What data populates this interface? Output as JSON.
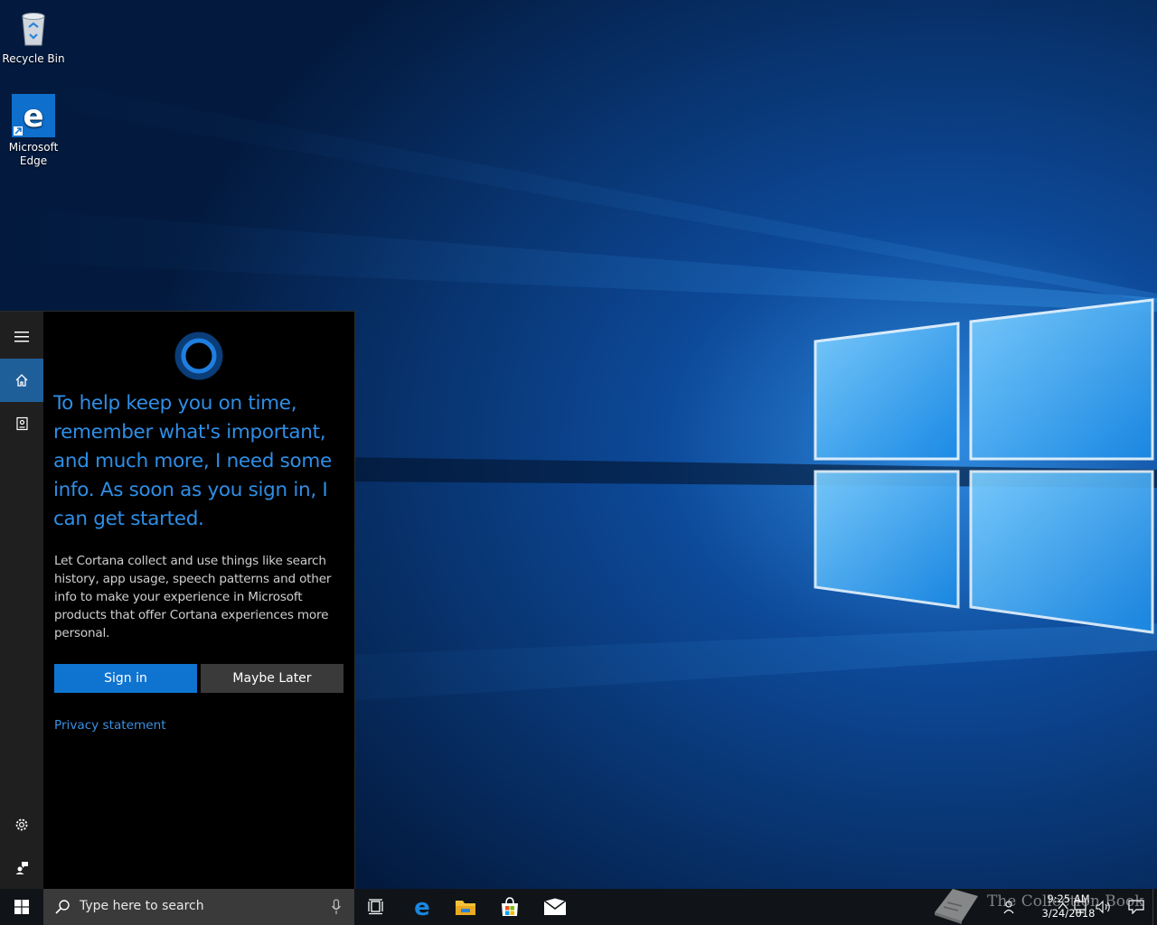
{
  "desktop": {
    "icons": [
      {
        "label": "Recycle Bin",
        "icon": "recycle-bin-icon"
      },
      {
        "label": "Microsoft Edge",
        "icon": "edge-icon"
      }
    ]
  },
  "cortana": {
    "rail": {
      "menu_icon": "hamburger-menu-icon",
      "home_icon": "home-icon",
      "notebook_icon": "notebook-icon",
      "settings_icon": "gear-icon",
      "feedback_icon": "feedback-icon"
    },
    "heading": "To help keep you on time, remember what's important, and much more, I need some info. As soon as you sign in, I can get started.",
    "body": "Let Cortana collect and use things like search history, app usage, speech patterns and other info to make your experience in Microsoft products that offer Cortana experiences more personal.",
    "signin_label": "Sign in",
    "maybe_later_label": "Maybe Later",
    "privacy_label": "Privacy statement",
    "accent": "#0f74d0",
    "heading_color": "#2f8ee6"
  },
  "taskbar": {
    "search_placeholder": "Type here to search",
    "pinned": [
      "task-view-icon",
      "edge-icon",
      "file-explorer-icon",
      "store-icon",
      "mail-icon"
    ],
    "clock": {
      "time": "9:25 AM",
      "date": "3/24/2018"
    }
  },
  "watermark": {
    "text": "The Collection Book"
  }
}
